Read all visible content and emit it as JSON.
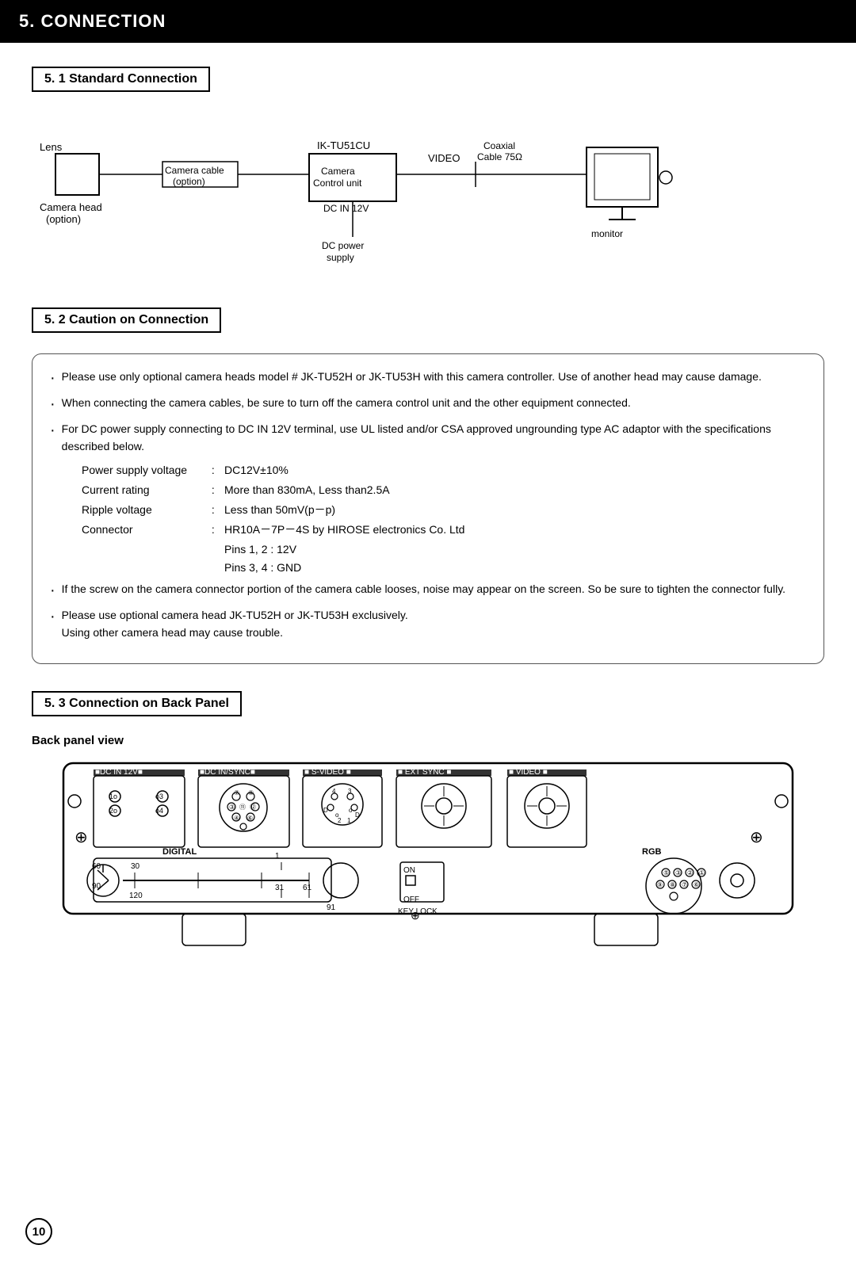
{
  "page": {
    "number": "10",
    "header": "5.  CONNECTION",
    "sections": {
      "s51": {
        "label": "5. 1   Standard Connection",
        "diagram": {
          "lens_label": "Lens",
          "camera_head_label": "Camera head\n(option)",
          "camera_cable_label": "Camera cable\n(option)",
          "ik_label": "IK-TU51CU",
          "camera_unit_label": "Camera\nControl unit",
          "video_label": "VIDEO",
          "coaxial_label": "Coaxial\nCable 75Ω",
          "dc_in_label": "DC IN 12V",
          "dc_power_label": "DC power\nsupply",
          "monitor_label": "monitor"
        }
      },
      "s52": {
        "label": "5. 2   Caution on Connection",
        "bullets": [
          "Please use only optional camera heads model # JK-TU52H or JK-TU53H with this camera controller. Use of another head may cause damage.",
          "When connecting the camera cables, be sure to turn off the camera control unit and the other equipment connected.",
          "For DC power supply connecting to DC IN 12V terminal, use UL listed and/or CSA approved ungrounding type AC adaptor with the specifications described below."
        ],
        "specs": [
          {
            "label": "Power supply voltage",
            "value": "DC12V±10%"
          },
          {
            "label": "Current rating",
            "value": "More than 830mA, Less than2.5A"
          },
          {
            "label": "Ripple voltage",
            "value": "Less than 50mV(p－p)"
          },
          {
            "label": "Connector",
            "value": "HR10A－7P－4S by HIROSE electronics Co. Ltd"
          }
        ],
        "pins": [
          "Pins 1, 2  :  12V",
          "Pins 3, 4  :  GND"
        ],
        "bullets2": [
          "If the screw on the camera connector portion of the camera cable looses, noise may appear on the screen. So be sure to tighten the connector fully.",
          "Please use optional camera head JK-TU52H or JK-TU53H exclusively.\nUsing other camera head may cause trouble."
        ]
      },
      "s53": {
        "label": "5. 3   Connection on Back Panel",
        "back_panel_label": "Back panel view",
        "connectors": [
          "DC IN 12V",
          "DC IN/SYNC",
          "S-VIDEO",
          "EXT SYNC",
          "VIDEO"
        ],
        "labels": [
          "DIGITAL",
          "RGB",
          "KEY LOCK"
        ],
        "numbers": [
          "30",
          "60",
          "90",
          "120",
          "1",
          "31",
          "61",
          "91",
          "ON",
          "OFF"
        ]
      }
    }
  }
}
